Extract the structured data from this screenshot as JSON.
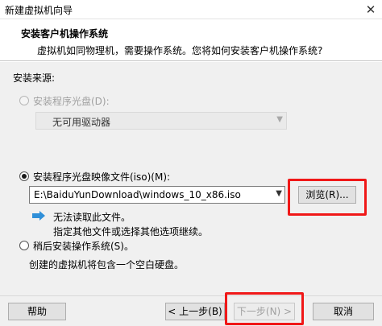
{
  "window": {
    "title": "新建虚拟机向导"
  },
  "header": {
    "title": "安装客户机操作系统",
    "subtitle": "虚拟机如同物理机，需要操作系统。您将如何安装客户机操作系统?"
  },
  "install_source": {
    "label": "安装来源:",
    "disc_option": {
      "label": "安装程序光盘(D):",
      "selected": false,
      "enabled": false
    },
    "disc_dropdown": {
      "value": "无可用驱动器"
    },
    "iso_option": {
      "label": "安装程序光盘映像文件(iso)(M):",
      "selected": true
    },
    "iso_path": {
      "value": "E:\\BaiduYunDownload\\windows_10_x86.iso"
    },
    "browse_label": "浏览(R)...",
    "info_lines": [
      "无法读取此文件。",
      "指定其他文件或选择其他选项继续。"
    ],
    "later_option": {
      "label": "稍后安装操作系统(S)。",
      "selected": false
    },
    "later_desc": "创建的虚拟机将包含一个空白硬盘。"
  },
  "footer": {
    "help_label": "帮助",
    "back_label": "< 上一步(B)",
    "next_label": "下一步(N) >",
    "cancel_label": "取消"
  },
  "colors": {
    "highlight": "#f01818",
    "accent": "#2f8fd8"
  }
}
